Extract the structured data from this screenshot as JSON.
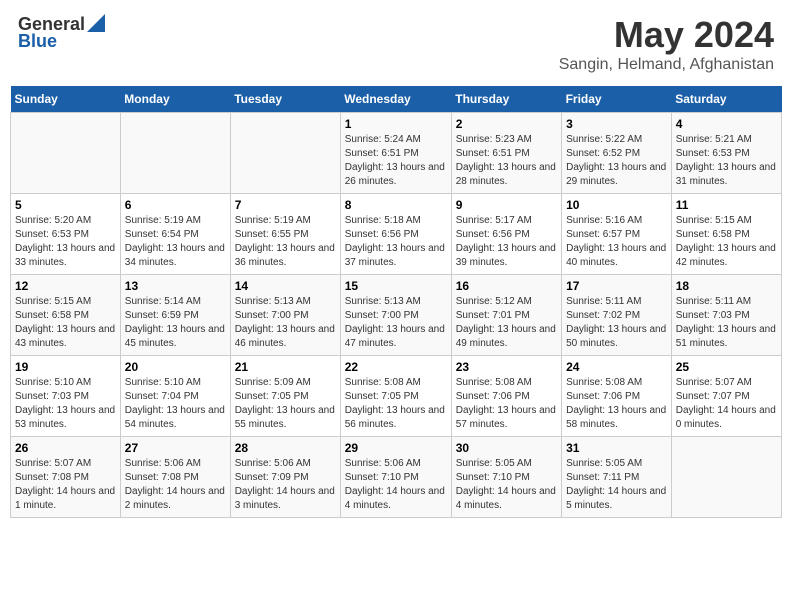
{
  "logo": {
    "general": "General",
    "blue": "Blue"
  },
  "title": "May 2024",
  "subtitle": "Sangin, Helmand, Afghanistan",
  "days_header": [
    "Sunday",
    "Monday",
    "Tuesday",
    "Wednesday",
    "Thursday",
    "Friday",
    "Saturday"
  ],
  "weeks": [
    [
      {
        "day": "",
        "info": ""
      },
      {
        "day": "",
        "info": ""
      },
      {
        "day": "",
        "info": ""
      },
      {
        "day": "1",
        "info": "Sunrise: 5:24 AM\nSunset: 6:51 PM\nDaylight: 13 hours and 26 minutes."
      },
      {
        "day": "2",
        "info": "Sunrise: 5:23 AM\nSunset: 6:51 PM\nDaylight: 13 hours and 28 minutes."
      },
      {
        "day": "3",
        "info": "Sunrise: 5:22 AM\nSunset: 6:52 PM\nDaylight: 13 hours and 29 minutes."
      },
      {
        "day": "4",
        "info": "Sunrise: 5:21 AM\nSunset: 6:53 PM\nDaylight: 13 hours and 31 minutes."
      }
    ],
    [
      {
        "day": "5",
        "info": "Sunrise: 5:20 AM\nSunset: 6:53 PM\nDaylight: 13 hours and 33 minutes."
      },
      {
        "day": "6",
        "info": "Sunrise: 5:19 AM\nSunset: 6:54 PM\nDaylight: 13 hours and 34 minutes."
      },
      {
        "day": "7",
        "info": "Sunrise: 5:19 AM\nSunset: 6:55 PM\nDaylight: 13 hours and 36 minutes."
      },
      {
        "day": "8",
        "info": "Sunrise: 5:18 AM\nSunset: 6:56 PM\nDaylight: 13 hours and 37 minutes."
      },
      {
        "day": "9",
        "info": "Sunrise: 5:17 AM\nSunset: 6:56 PM\nDaylight: 13 hours and 39 minutes."
      },
      {
        "day": "10",
        "info": "Sunrise: 5:16 AM\nSunset: 6:57 PM\nDaylight: 13 hours and 40 minutes."
      },
      {
        "day": "11",
        "info": "Sunrise: 5:15 AM\nSunset: 6:58 PM\nDaylight: 13 hours and 42 minutes."
      }
    ],
    [
      {
        "day": "12",
        "info": "Sunrise: 5:15 AM\nSunset: 6:58 PM\nDaylight: 13 hours and 43 minutes."
      },
      {
        "day": "13",
        "info": "Sunrise: 5:14 AM\nSunset: 6:59 PM\nDaylight: 13 hours and 45 minutes."
      },
      {
        "day": "14",
        "info": "Sunrise: 5:13 AM\nSunset: 7:00 PM\nDaylight: 13 hours and 46 minutes."
      },
      {
        "day": "15",
        "info": "Sunrise: 5:13 AM\nSunset: 7:00 PM\nDaylight: 13 hours and 47 minutes."
      },
      {
        "day": "16",
        "info": "Sunrise: 5:12 AM\nSunset: 7:01 PM\nDaylight: 13 hours and 49 minutes."
      },
      {
        "day": "17",
        "info": "Sunrise: 5:11 AM\nSunset: 7:02 PM\nDaylight: 13 hours and 50 minutes."
      },
      {
        "day": "18",
        "info": "Sunrise: 5:11 AM\nSunset: 7:03 PM\nDaylight: 13 hours and 51 minutes."
      }
    ],
    [
      {
        "day": "19",
        "info": "Sunrise: 5:10 AM\nSunset: 7:03 PM\nDaylight: 13 hours and 53 minutes."
      },
      {
        "day": "20",
        "info": "Sunrise: 5:10 AM\nSunset: 7:04 PM\nDaylight: 13 hours and 54 minutes."
      },
      {
        "day": "21",
        "info": "Sunrise: 5:09 AM\nSunset: 7:05 PM\nDaylight: 13 hours and 55 minutes."
      },
      {
        "day": "22",
        "info": "Sunrise: 5:08 AM\nSunset: 7:05 PM\nDaylight: 13 hours and 56 minutes."
      },
      {
        "day": "23",
        "info": "Sunrise: 5:08 AM\nSunset: 7:06 PM\nDaylight: 13 hours and 57 minutes."
      },
      {
        "day": "24",
        "info": "Sunrise: 5:08 AM\nSunset: 7:06 PM\nDaylight: 13 hours and 58 minutes."
      },
      {
        "day": "25",
        "info": "Sunrise: 5:07 AM\nSunset: 7:07 PM\nDaylight: 14 hours and 0 minutes."
      }
    ],
    [
      {
        "day": "26",
        "info": "Sunrise: 5:07 AM\nSunset: 7:08 PM\nDaylight: 14 hours and 1 minute."
      },
      {
        "day": "27",
        "info": "Sunrise: 5:06 AM\nSunset: 7:08 PM\nDaylight: 14 hours and 2 minutes."
      },
      {
        "day": "28",
        "info": "Sunrise: 5:06 AM\nSunset: 7:09 PM\nDaylight: 14 hours and 3 minutes."
      },
      {
        "day": "29",
        "info": "Sunrise: 5:06 AM\nSunset: 7:10 PM\nDaylight: 14 hours and 4 minutes."
      },
      {
        "day": "30",
        "info": "Sunrise: 5:05 AM\nSunset: 7:10 PM\nDaylight: 14 hours and 4 minutes."
      },
      {
        "day": "31",
        "info": "Sunrise: 5:05 AM\nSunset: 7:11 PM\nDaylight: 14 hours and 5 minutes."
      },
      {
        "day": "",
        "info": ""
      }
    ]
  ]
}
